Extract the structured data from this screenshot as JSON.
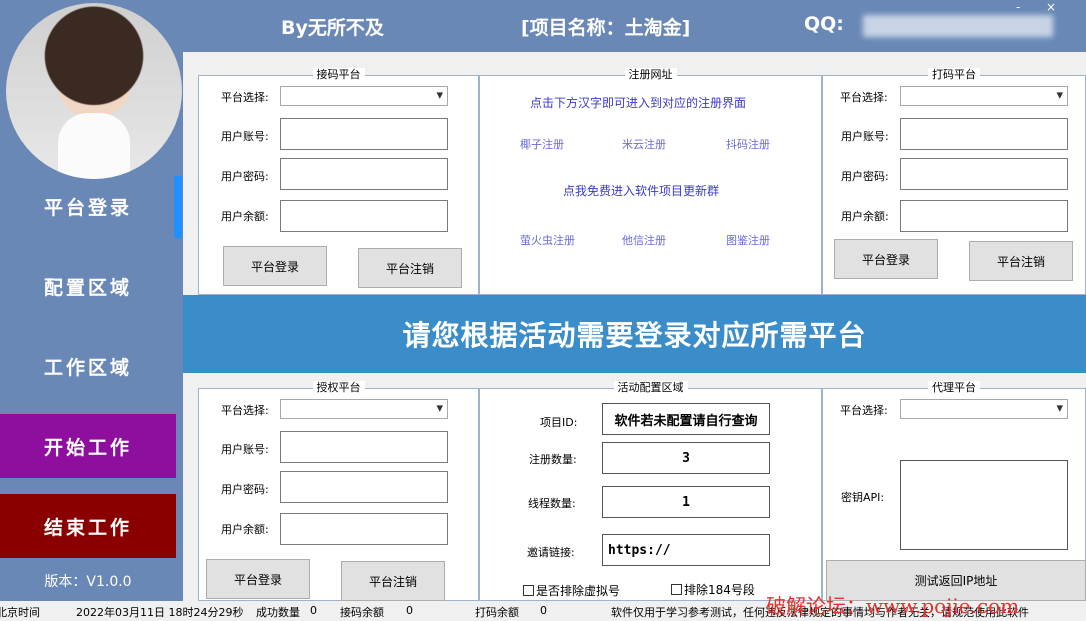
{
  "header": {
    "author": "By无所不及",
    "project": "[项目名称：土淘金]",
    "qq_label": "QQ:",
    "min": "-",
    "close": "×"
  },
  "sidebar": {
    "items": [
      {
        "label": "平台登录"
      },
      {
        "label": "配置区域"
      },
      {
        "label": "工作区域"
      }
    ],
    "start": "开始工作",
    "stop": "结束工作",
    "version": "版本：V1.0.0"
  },
  "receive_platform": {
    "title": "接码平台",
    "platform_label": "平台选择:",
    "account_label": "用户账号:",
    "password_label": "用户密码:",
    "balance_label": "用户余额:",
    "login": "平台登录",
    "logout": "平台注销"
  },
  "register": {
    "title": "注册网址",
    "hint": "点击下方汉字即可进入到对应的注册界面",
    "links_row1": [
      "椰子注册",
      "米云注册",
      "抖码注册"
    ],
    "group_link": "点我免费进入软件项目更新群",
    "links_row2": [
      "萤火虫注册",
      "他信注册",
      "图鉴注册"
    ]
  },
  "captcha_platform": {
    "title": "打码平台",
    "platform_label": "平台选择:",
    "account_label": "用户账号:",
    "password_label": "用户密码:",
    "balance_label": "用户余额:",
    "login": "平台登录",
    "logout": "平台注销"
  },
  "banner": "请您根据活动需要登录对应所需平台",
  "auth_platform": {
    "title": "授权平台",
    "platform_label": "平台选择:",
    "account_label": "用户账号:",
    "password_label": "用户密码:",
    "balance_label": "用户余额:",
    "login": "平台登录",
    "logout": "平台注销"
  },
  "activity": {
    "title": "活动配置区域",
    "project_id_label": "项目ID:",
    "project_id_value": "软件若未配置请自行查询",
    "register_count_label": "注册数量:",
    "register_count_value": "3",
    "thread_count_label": "线程数量:",
    "thread_count_value": "1",
    "invite_label": "邀请链接:",
    "invite_value": "https://",
    "exclude_virtual": "是否排除虚拟号",
    "exclude_184": "排除184号段"
  },
  "proxy": {
    "title": "代理平台",
    "platform_label": "平台选择:",
    "key_label": "密钥API:",
    "test_button": "测试返回IP地址"
  },
  "status": {
    "time_label": "北京时间",
    "time_value": "2022年03月11日 18时24分29秒",
    "success_label": "成功数量",
    "success_value": "0",
    "receive_balance_label": "接码余额",
    "receive_balance_value": "0",
    "captcha_balance_label": "打码余额",
    "captcha_balance_value": "0",
    "notice": "软件仅用于学习参考测试，任何违反法律规定的事情均与作者无关，请规范使用此软件",
    "watermark": "破解论坛：www.pojie.com"
  }
}
